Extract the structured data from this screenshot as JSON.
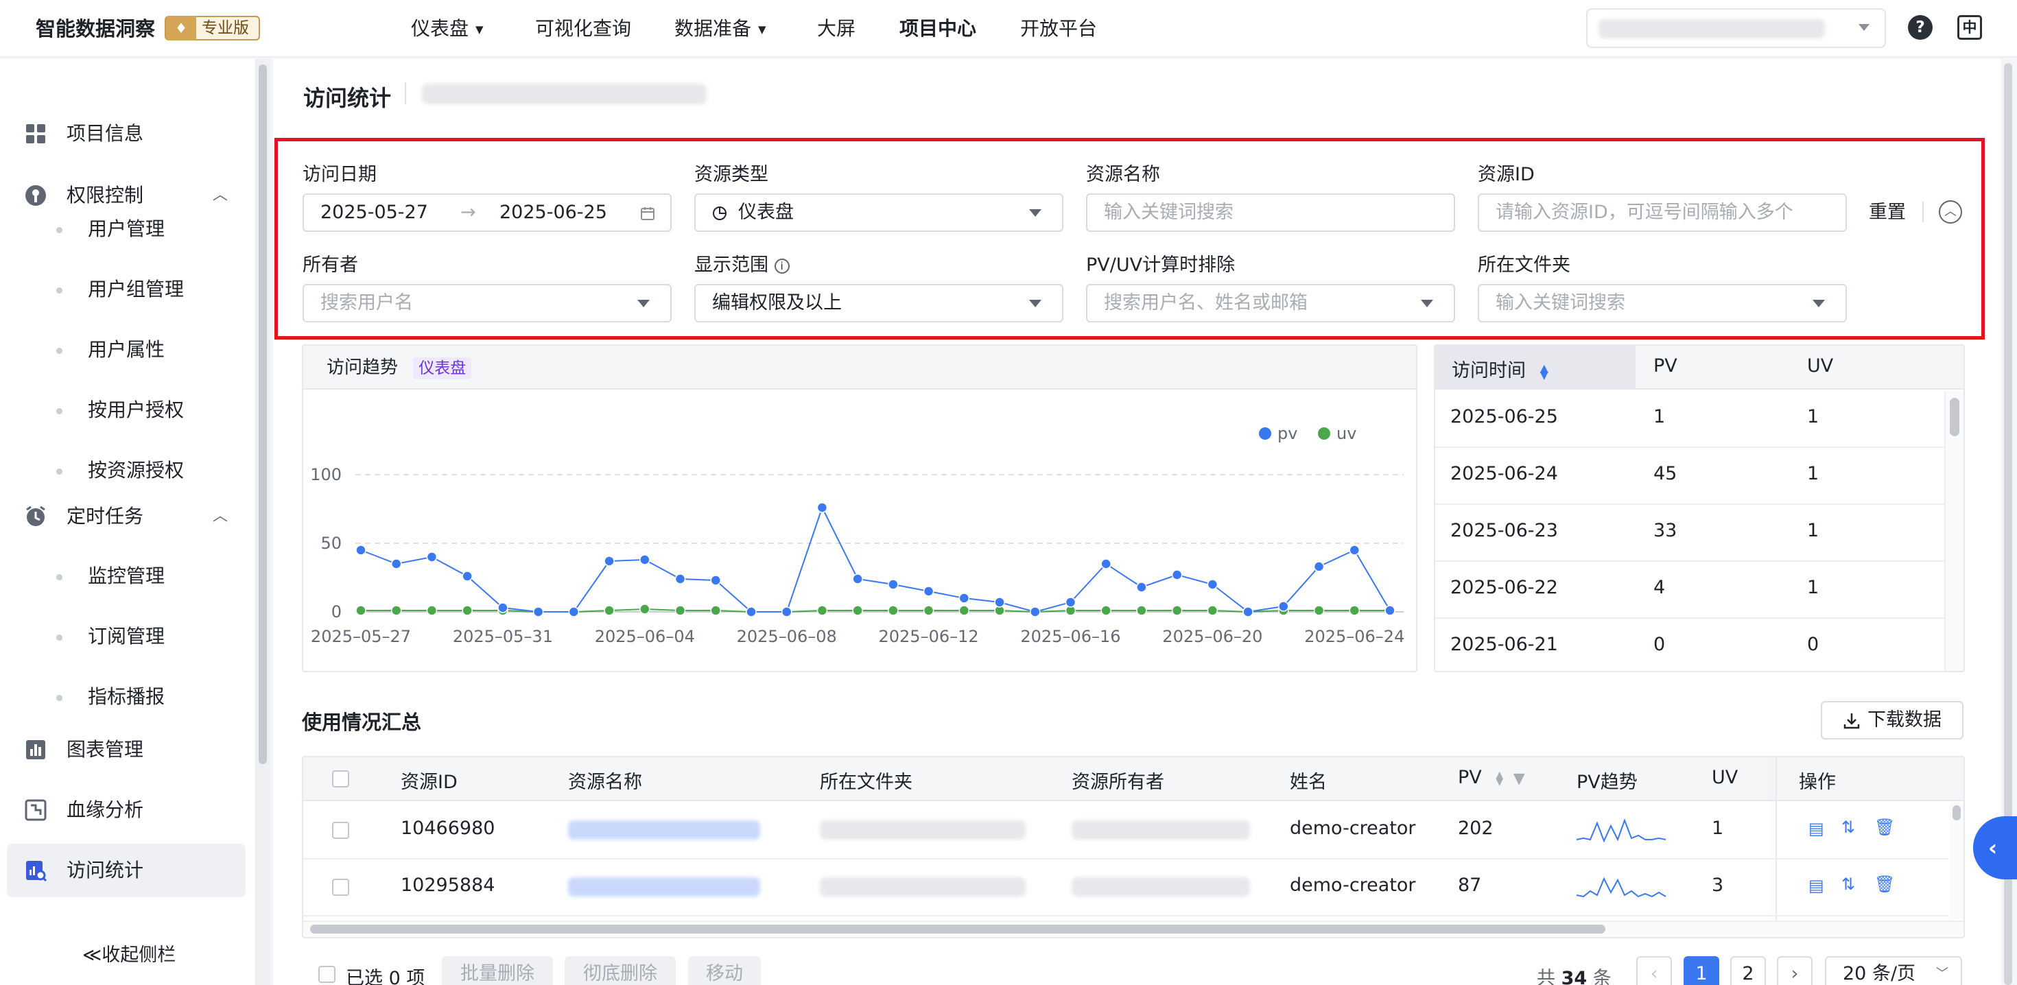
{
  "app": {
    "brand": "智能数据洞察",
    "edition": "专业版",
    "nav": [
      "仪表盘",
      "可视化查询",
      "数据准备",
      "大屏",
      "项目中心",
      "开放平台"
    ]
  },
  "sidebar": {
    "items": [
      {
        "label": "项目信息"
      },
      {
        "label": "权限控制"
      },
      {
        "label": "用户管理"
      },
      {
        "label": "用户组管理"
      },
      {
        "label": "用户属性"
      },
      {
        "label": "按用户授权"
      },
      {
        "label": "按资源授权"
      },
      {
        "label": "定时任务"
      },
      {
        "label": "监控管理"
      },
      {
        "label": "订阅管理"
      },
      {
        "label": "指标播报"
      },
      {
        "label": "图表管理"
      },
      {
        "label": "血缘分析"
      },
      {
        "label": "访问统计"
      }
    ],
    "collapse": "收起侧栏"
  },
  "page": {
    "title": "访问统计"
  },
  "filters": {
    "date_label": "访问日期",
    "date_start": "2025-05-27",
    "date_end": "2025-06-25",
    "type_label": "资源类型",
    "type_value": "仪表盘",
    "name_label": "资源名称",
    "name_placeholder": "输入关键词搜索",
    "id_label": "资源ID",
    "id_placeholder": "请输入资源ID，可逗号间隔输入多个",
    "reset": "重置",
    "owner_label": "所有者",
    "owner_placeholder": "搜索用户名",
    "scope_label": "显示范围",
    "scope_value": "编辑权限及以上",
    "exclude_label": "PV/UV计算时排除",
    "exclude_placeholder": "搜索用户名、姓名或邮箱",
    "folder_label": "所在文件夹",
    "folder_placeholder": "输入关键词搜索"
  },
  "trend": {
    "title": "访问趋势",
    "tag": "仪表盘",
    "colors": {
      "pv": "#3a78f2",
      "uv": "#4aa84a"
    }
  },
  "chart_data": {
    "type": "line",
    "x": [
      "2025-05-27",
      "2025-05-28",
      "2025-05-29",
      "2025-05-30",
      "2025-05-31",
      "2025-06-01",
      "2025-06-02",
      "2025-06-03",
      "2025-06-04",
      "2025-06-05",
      "2025-06-06",
      "2025-06-07",
      "2025-06-08",
      "2025-06-09",
      "2025-06-10",
      "2025-06-11",
      "2025-06-12",
      "2025-06-13",
      "2025-06-14",
      "2025-06-15",
      "2025-06-16",
      "2025-06-17",
      "2025-06-18",
      "2025-06-19",
      "2025-06-20",
      "2025-06-21",
      "2025-06-22",
      "2025-06-23",
      "2025-06-24",
      "2025-06-25"
    ],
    "tick_labels": [
      "2025–05–27",
      "2025–05–31",
      "2025–06–04",
      "2025–06–08",
      "2025–06–12",
      "2025–06–16",
      "2025–06–20",
      "2025–06–24"
    ],
    "series": [
      {
        "name": "pv",
        "values": [
          45,
          35,
          40,
          26,
          3,
          0,
          0,
          37,
          38,
          24,
          23,
          0,
          0,
          76,
          24,
          20,
          15,
          10,
          7,
          0,
          7,
          35,
          18,
          27,
          20,
          0,
          4,
          33,
          45,
          1
        ]
      },
      {
        "name": "uv",
        "values": [
          1,
          1,
          1,
          1,
          1,
          0,
          0,
          1,
          2,
          1,
          1,
          0,
          0,
          1,
          1,
          1,
          1,
          1,
          1,
          0,
          1,
          1,
          1,
          1,
          1,
          0,
          1,
          1,
          1,
          1
        ]
      }
    ],
    "yticks": [
      0,
      50,
      100
    ],
    "ylim": [
      0,
      100
    ],
    "grid": true,
    "legend": "top-right"
  },
  "daily": {
    "headers": [
      "访问时间",
      "PV",
      "UV"
    ],
    "rows": [
      [
        "2025-06-25",
        "1",
        "1"
      ],
      [
        "2025-06-24",
        "45",
        "1"
      ],
      [
        "2025-06-23",
        "33",
        "1"
      ],
      [
        "2025-06-22",
        "4",
        "1"
      ],
      [
        "2025-06-21",
        "0",
        "0"
      ]
    ]
  },
  "summary": {
    "title": "使用情况汇总",
    "download": "下载数据",
    "headers": [
      "资源ID",
      "资源名称",
      "所在文件夹",
      "资源所有者",
      "姓名",
      "PV",
      "PV趋势",
      "UV",
      "操作"
    ],
    "rows": [
      {
        "id": "10466980",
        "name_display": "demo-creator",
        "pv": "202",
        "uv": "1"
      },
      {
        "id": "10295884",
        "name_display": "demo-creator",
        "pv": "87",
        "uv": "3"
      }
    ]
  },
  "footer": {
    "selected": "已选 0 项",
    "batch_delete": "批量删除",
    "purge": "彻底删除",
    "move": "移动",
    "total_prefix": "共",
    "total": "34",
    "total_suffix": "条",
    "pages": [
      "1",
      "2"
    ],
    "page_size": "20 条/页"
  }
}
